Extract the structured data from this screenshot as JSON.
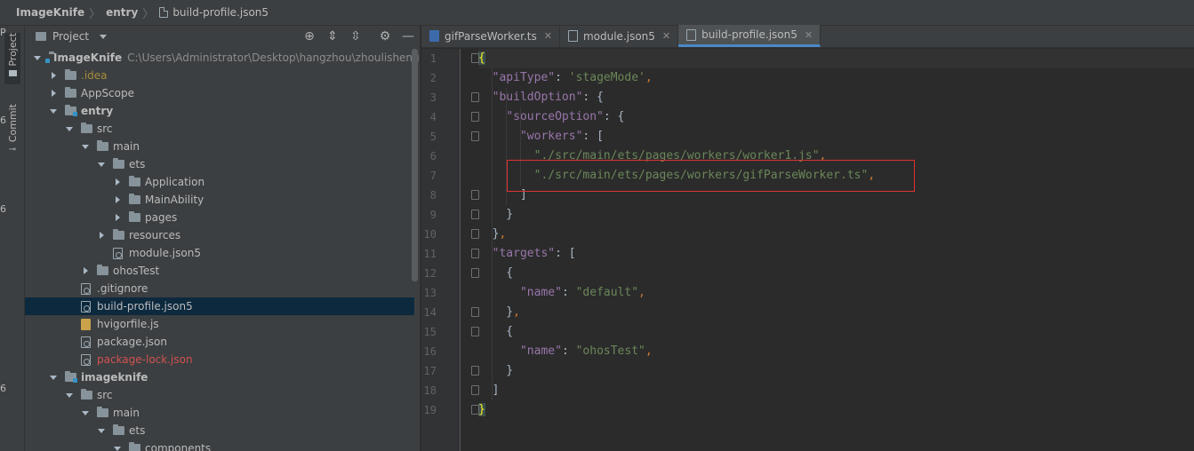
{
  "breadcrumb": {
    "items": [
      "ImageKnife",
      "entry",
      "build-profile.json5"
    ]
  },
  "tool_stripe": {
    "project_label": "Project",
    "commit_label": "Commit",
    "edge_chars": [
      "R",
      "6",
      "6",
      "6"
    ]
  },
  "project_panel": {
    "title": "Project",
    "tree": [
      {
        "label": "ImageKnife",
        "path": "C:\\Users\\Administrator\\Desktop\\hangzhou\\zhoulisheng\\Image",
        "bold": true,
        "expanded": true,
        "icon": "folder-module"
      },
      {
        "label": ".idea",
        "color": "idea",
        "expanded": false,
        "icon": "folder"
      },
      {
        "label": "AppScope",
        "expanded": false,
        "icon": "folder"
      },
      {
        "label": "entry",
        "bold": true,
        "expanded": true,
        "icon": "folder-module"
      },
      {
        "label": "src",
        "expanded": true,
        "icon": "folder"
      },
      {
        "label": "main",
        "expanded": true,
        "icon": "folder"
      },
      {
        "label": "ets",
        "expanded": true,
        "icon": "folder"
      },
      {
        "label": "Application",
        "expanded": false,
        "icon": "folder"
      },
      {
        "label": "MainAbility",
        "expanded": false,
        "icon": "folder"
      },
      {
        "label": "pages",
        "expanded": false,
        "icon": "folder"
      },
      {
        "label": "resources",
        "expanded": false,
        "icon": "folder"
      },
      {
        "label": "module.json5",
        "icon": "file-gear"
      },
      {
        "label": "ohosTest",
        "expanded": false,
        "icon": "folder"
      },
      {
        "label": ".gitignore",
        "icon": "file-gear"
      },
      {
        "label": "build-profile.json5",
        "icon": "file-gear",
        "selected": true
      },
      {
        "label": "hvigorfile.js",
        "icon": "file-js"
      },
      {
        "label": "package.json",
        "icon": "file-gear"
      },
      {
        "label": "package-lock.json",
        "color": "err",
        "icon": "file-gear"
      },
      {
        "label": "imageknife",
        "bold": true,
        "expanded": true,
        "icon": "folder-module"
      },
      {
        "label": "src",
        "expanded": true,
        "icon": "folder"
      },
      {
        "label": "main",
        "expanded": true,
        "icon": "folder"
      },
      {
        "label": "ets",
        "expanded": true,
        "icon": "folder"
      },
      {
        "label": "components",
        "expanded": true,
        "icon": "folder"
      }
    ]
  },
  "editor": {
    "tabs": [
      {
        "label": "gifParseWorker.ts",
        "active": false
      },
      {
        "label": "module.json5",
        "active": false
      },
      {
        "label": "build-profile.json5",
        "active": true
      }
    ],
    "line_numbers": [
      "1",
      "2",
      "3",
      "4",
      "5",
      "6",
      "7",
      "8",
      "9",
      "10",
      "11",
      "12",
      "13",
      "14",
      "15",
      "16",
      "17",
      "18",
      "19"
    ],
    "code": {
      "l1_open": "{",
      "l2_key": "\"apiType\"",
      "l2_val": "'stageMode'",
      "l3_key": "\"buildOption\"",
      "l4_key": "\"sourceOption\"",
      "l5_key": "\"workers\"",
      "l6_val": "\"./src/main/ets/pages/workers/worker1.js\"",
      "l7_val": "\"./src/main/ets/pages/workers/gifParseWorker.ts\"",
      "l11_key": "\"targets\"",
      "l13_key": "\"name\"",
      "l13_val": "\"default\"",
      "l16_key": "\"name\"",
      "l16_val": "\"ohosTest\"",
      "l19_close": "}"
    }
  },
  "colors": {
    "highlight_box": "#e03131",
    "selection": "#0d293e",
    "string": "#6a8759",
    "key": "#9876aa"
  }
}
